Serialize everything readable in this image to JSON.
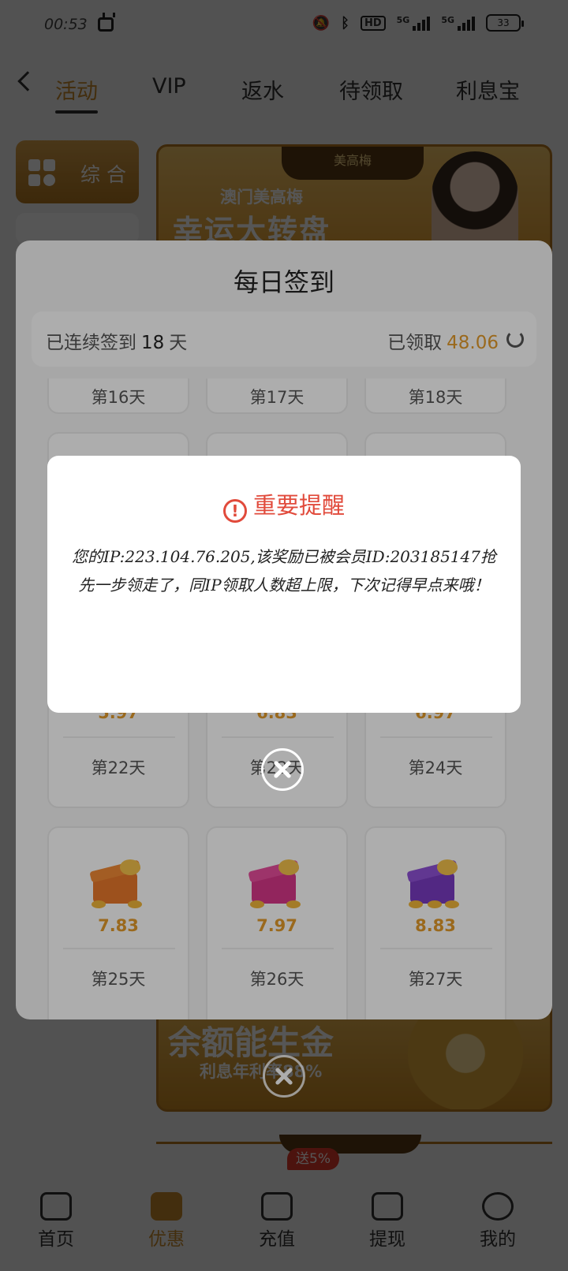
{
  "status_bar": {
    "time": "00:53",
    "network": "5G",
    "hd": "HD",
    "battery": "33"
  },
  "top_tabs": [
    "活动",
    "VIP",
    "返水",
    "待领取",
    "利息宝"
  ],
  "side_menu": {
    "active": "综合"
  },
  "banner_top": {
    "brand": "美高梅",
    "subtitle": "澳门美高梅",
    "title": "幸运大转盘"
  },
  "banner_bottom": {
    "title": "余额能生金",
    "subtitle": "利息年利率88%"
  },
  "signin": {
    "title": "每日签到",
    "streak_prefix": "已连续签到",
    "streak_days": "18",
    "streak_suffix": "天",
    "claimed_label": "已领取",
    "claimed_amount": "48.06",
    "days": [
      {
        "label": "第16天",
        "amount": ""
      },
      {
        "label": "第17天",
        "amount": ""
      },
      {
        "label": "第18天",
        "amount": ""
      },
      {
        "label": "第22天",
        "amount": "5.97"
      },
      {
        "label": "第23天",
        "amount": "6.83"
      },
      {
        "label": "第24天",
        "amount": "6.97"
      },
      {
        "label": "第25天",
        "amount": "7.83"
      },
      {
        "label": "第26天",
        "amount": "7.97"
      },
      {
        "label": "第27天",
        "amount": "8.83"
      }
    ]
  },
  "alert": {
    "title": "重要提醒",
    "message": "您的IP:223.104.76.205,该奖励已被会员ID:203185147抢先一步领走了，同IP领取人数超上限，下次记得早点来哦！"
  },
  "bottom_nav": {
    "items": [
      "首页",
      "优惠",
      "充值",
      "提现",
      "我的"
    ],
    "recharge_badge": "送5%"
  },
  "colors": {
    "accent": "#c88a2a",
    "amount": "#e39b2c",
    "alert_red": "#e14a3b"
  }
}
